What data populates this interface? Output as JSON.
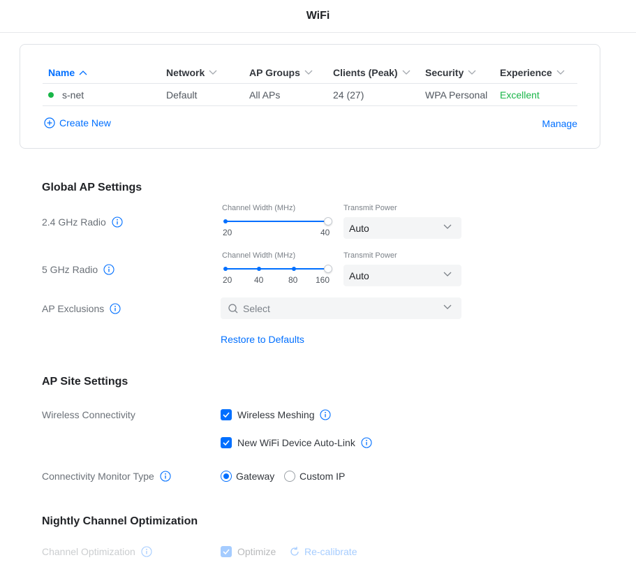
{
  "header": {
    "title": "WiFi"
  },
  "wifi_table": {
    "columns": [
      "Name",
      "Network",
      "AP Groups",
      "Clients (Peak)",
      "Security",
      "Experience"
    ],
    "rows": [
      {
        "name": "s-net",
        "network": "Default",
        "ap_groups": "All APs",
        "clients": "24 (27)",
        "security": "WPA Personal",
        "experience": "Excellent"
      }
    ],
    "create_label": "Create New",
    "manage_label": "Manage"
  },
  "global_ap": {
    "title": "Global AP Settings",
    "radio_24": {
      "label": "2.4 GHz Radio",
      "channel_width_label": "Channel Width (MHz)",
      "channel_options": [
        "20",
        "40"
      ],
      "channel_selected": "40",
      "transmit_label": "Transmit Power",
      "transmit_value": "Auto"
    },
    "radio_5": {
      "label": "5 GHz Radio",
      "channel_width_label": "Channel Width (MHz)",
      "channel_options": [
        "20",
        "40",
        "80",
        "160"
      ],
      "channel_selected": "160",
      "transmit_label": "Transmit Power",
      "transmit_value": "Auto"
    },
    "exclusions": {
      "label": "AP Exclusions",
      "placeholder": "Select"
    },
    "restore_label": "Restore to Defaults"
  },
  "site_settings": {
    "title": "AP Site Settings",
    "wireless_connectivity_label": "Wireless Connectivity",
    "meshing_label": "Wireless Meshing",
    "meshing_checked": true,
    "autolink_label": "New WiFi Device Auto-Link",
    "autolink_checked": true,
    "monitor_label": "Connectivity Monitor Type",
    "monitor_options": [
      "Gateway",
      "Custom IP"
    ],
    "monitor_selected": "Gateway"
  },
  "nightly": {
    "title": "Nightly Channel Optimization",
    "channel_opt_label": "Channel Optimization",
    "optimize_label": "Optimize",
    "recalibrate_label": "Re-calibrate"
  },
  "colors": {
    "accent": "#006fff",
    "success": "#19b648"
  }
}
